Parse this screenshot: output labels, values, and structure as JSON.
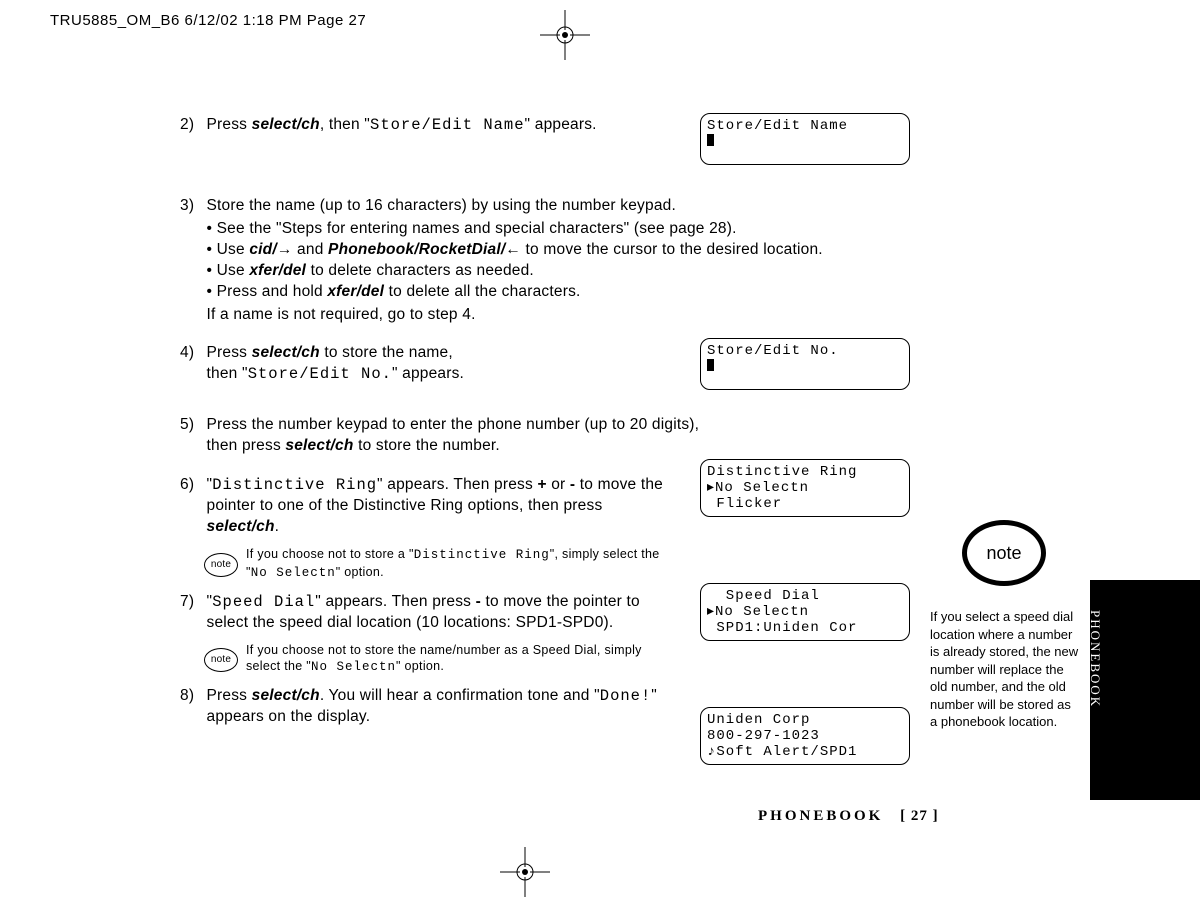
{
  "header": "TRU5885_OM_B6  6/12/02  1:18 PM  Page 27",
  "steps": {
    "s2_a": "Press ",
    "s2_key": "select/ch",
    "s2_b": ", then \"",
    "s2_lcd": "Store/Edit Name",
    "s2_c": "\" appears.",
    "s3_lead": "Store the name (up to 16 characters) by using the number keypad.",
    "s3_b1": "• See the \"Steps for entering names and special characters\" (see page 28).",
    "s3_b2a": "• Use ",
    "s3_b2_cid": "cid/",
    "s3_b2_arrowR": "→",
    "s3_b2b": " and ",
    "s3_b2_pb": "Phonebook/RocketDial/",
    "s3_b2_arrowL": "←",
    "s3_b2c": " to move the cursor to the desired location.",
    "s3_b3a": "• Use ",
    "s3_b3_key": "xfer/del",
    "s3_b3b": " to delete characters as needed.",
    "s3_b4a": "• Press and hold ",
    "s3_b4_key": "xfer/del",
    "s3_b4b": " to delete all the characters.",
    "s3_tail": "If a name is not required, go to step 4.",
    "s4_a": "Press ",
    "s4_key": "select/ch",
    "s4_b": " to store the name,",
    "s4_c": "then \"",
    "s4_lcd": "Store/Edit No.",
    "s4_d": "\" appears.",
    "s5_a": "Press the number keypad to enter the phone number (up to 20 digits),",
    "s5_b": "then press ",
    "s5_key": "select/ch",
    "s5_c": " to store the number.",
    "s6_a": "\"",
    "s6_lcd": "Distinctive Ring",
    "s6_b": "\" appears. Then press ",
    "s6_plus": "+",
    "s6_c": " or ",
    "s6_minus": "-",
    "s6_d": " to move the pointer to one of the Distinctive Ring options, then press ",
    "s6_key": "select/ch",
    "s6_e": ".",
    "note1_a": "If you choose not to store a \"",
    "note1_lcd1": "Distinctive Ring",
    "note1_b": "\", simply select the \"",
    "note1_lcd2": "No Selectn",
    "note1_c": "\" option.",
    "s7_a": "\"",
    "s7_lcd": "Speed Dial",
    "s7_b": "\" appears. Then press ",
    "s7_minus": "-",
    "s7_c": " to move the pointer to select the speed dial location (10 locations: SPD1-SPD0).",
    "note2_a": "If you choose not to store the name/number as a Speed Dial, simply select the \"",
    "note2_lcd": "No Selectn",
    "note2_b": "\" option.",
    "s8_a": "Press ",
    "s8_key": "select/ch",
    "s8_b": ". You will hear a confirmation tone and \"",
    "s8_lcd": "Done!",
    "s8_c": "\" appears on the display."
  },
  "lcd_boxes": {
    "box1_l1": "Store/Edit Name",
    "box2_l1": "Store/Edit No.",
    "box3_l1": "Distinctive Ring",
    "box3_l2": "▸No Selectn",
    "box3_l3": " Flicker",
    "box4_l1": "  Speed Dial",
    "box4_l2": "▸No Selectn",
    "box4_l3": " SPD1:Uniden Cor",
    "box5_l1": "Uniden Corp",
    "box5_l2": "800-297-1023",
    "box5_l3": "♪Soft Alert/SPD1"
  },
  "note_label": "note",
  "side_note": "If you select a speed dial location where a number is already stored, the new number will replace the old number, and the old number will be stored as a phonebook location.",
  "tab_label": "PHONEBOOK",
  "footer_label": "PHONEBOOK",
  "footer_page": "[ 27 ]"
}
